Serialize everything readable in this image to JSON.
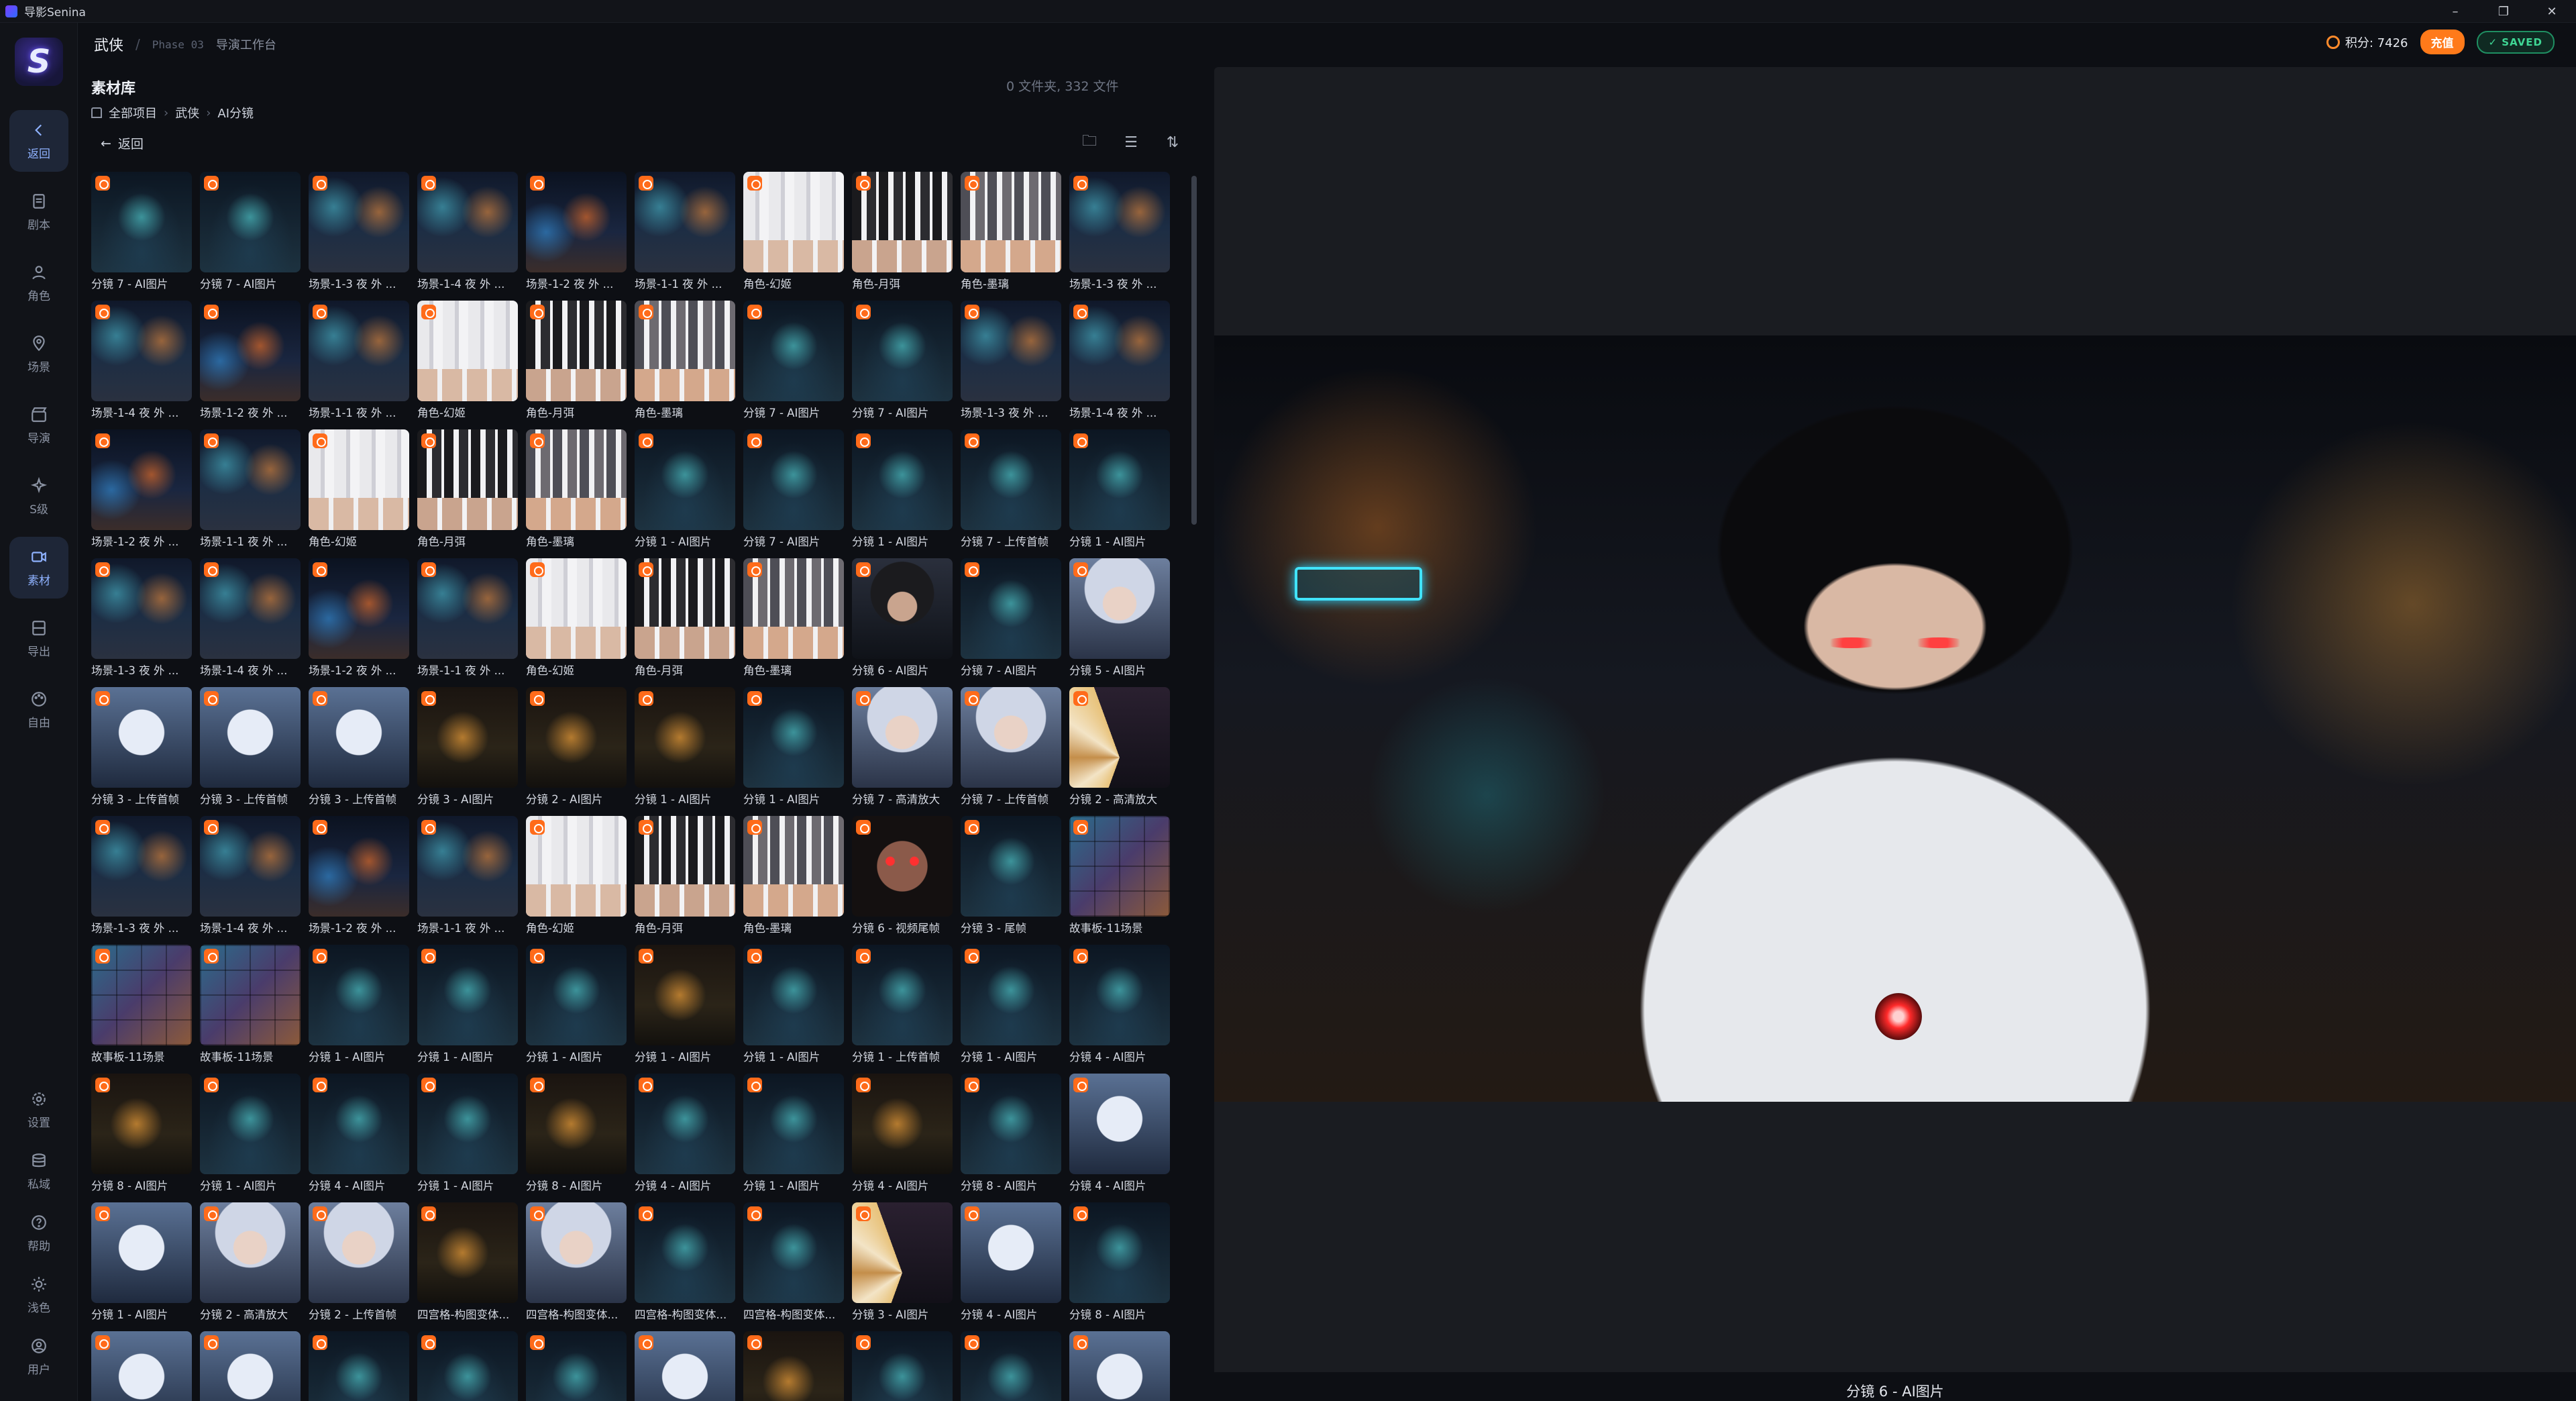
{
  "app": {
    "title": "导影Senina"
  },
  "window_controls": {
    "minimize": "–",
    "restore": "❐",
    "close": "✕"
  },
  "sidebar": {
    "items": [
      {
        "label": "返回",
        "icon": "chevron-left-icon",
        "active": true
      },
      {
        "label": "剧本",
        "icon": "document-icon",
        "active": false
      },
      {
        "label": "角色",
        "icon": "user-icon",
        "active": false
      },
      {
        "label": "场景",
        "icon": "location-icon",
        "active": false
      },
      {
        "label": "导演",
        "icon": "clapper-icon",
        "active": false
      },
      {
        "label": "S级",
        "icon": "sparkle-icon",
        "active": false
      },
      {
        "label": "素材",
        "icon": "video-icon",
        "active": true
      },
      {
        "label": "导出",
        "icon": "film-icon",
        "active": false
      },
      {
        "label": "自由",
        "icon": "palette-icon",
        "active": false
      }
    ],
    "bottom_items": [
      {
        "label": "设置",
        "icon": "gear-icon"
      },
      {
        "label": "私域",
        "icon": "database-icon"
      },
      {
        "label": "帮助",
        "icon": "help-icon"
      },
      {
        "label": "浅色",
        "icon": "sun-icon"
      },
      {
        "label": "用户",
        "icon": "user-circle-icon"
      }
    ]
  },
  "header": {
    "project": "武侠",
    "separator": "/",
    "phase": "Phase 03",
    "workspace": "导演工作台",
    "points_label": "积分: 7426",
    "recharge_label": "充值",
    "saved_label": "✓ SAVED"
  },
  "library": {
    "title": "素材库",
    "count": "0 文件夹, 332 文件",
    "breadcrumb": [
      "全部项目",
      "武侠",
      "AI分镜"
    ],
    "back_label": "返回",
    "tools": {
      "new_folder": "🗀",
      "list_view": "☰",
      "sort": "⇅"
    }
  },
  "grid": {
    "items": [
      {
        "cap": "分镜 7 - AI图片",
        "art": "action"
      },
      {
        "cap": "分镜 7 - AI图片",
        "art": "action"
      },
      {
        "cap": "场景-1-3 夜 外 ...",
        "art": "scene"
      },
      {
        "cap": "场景-1-4 夜 外 ...",
        "art": "scene"
      },
      {
        "cap": "场景-1-2 夜 外 ...",
        "art": "scene2"
      },
      {
        "cap": "场景-1-1 夜 外 ...",
        "art": "scene"
      },
      {
        "cap": "角色-幻姬",
        "art": "sheet-w"
      },
      {
        "cap": "角色-月弭",
        "art": "sheet-d"
      },
      {
        "cap": "角色-墨璃",
        "art": "sheet-g"
      },
      {
        "cap": "场景-1-3 夜 外 ...",
        "art": "scene"
      },
      {
        "cap": "场景-1-4 夜 外 ...",
        "art": "scene"
      },
      {
        "cap": "场景-1-2 夜 外 ...",
        "art": "scene2"
      },
      {
        "cap": "场景-1-1 夜 外 ...",
        "art": "scene"
      },
      {
        "cap": "角色-幻姬",
        "art": "sheet-w"
      },
      {
        "cap": "角色-月弭",
        "art": "sheet-d"
      },
      {
        "cap": "角色-墨璃",
        "art": "sheet-g"
      },
      {
        "cap": "分镜 7 - AI图片",
        "art": "action"
      },
      {
        "cap": "分镜 7 - AI图片",
        "art": "action"
      },
      {
        "cap": "场景-1-3 夜 外 ...",
        "art": "scene"
      },
      {
        "cap": "场景-1-4 夜 外 ...",
        "art": "scene"
      },
      {
        "cap": "场景-1-2 夜 外 ...",
        "art": "scene2"
      },
      {
        "cap": "场景-1-1 夜 外 ...",
        "art": "scene"
      },
      {
        "cap": "角色-幻姬",
        "art": "sheet-w"
      },
      {
        "cap": "角色-月弭",
        "art": "sheet-d"
      },
      {
        "cap": "角色-墨璃",
        "art": "sheet-g"
      },
      {
        "cap": "分镜 1 - AI图片",
        "art": "action"
      },
      {
        "cap": "分镜 7 - AI图片",
        "art": "action"
      },
      {
        "cap": "分镜 1 - AI图片",
        "art": "action"
      },
      {
        "cap": "分镜 7 - 上传首帧",
        "art": "action"
      },
      {
        "cap": "分镜 1 - AI图片",
        "art": "action"
      },
      {
        "cap": "场景-1-3 夜 外 ...",
        "art": "scene"
      },
      {
        "cap": "场景-1-4 夜 外 ...",
        "art": "scene"
      },
      {
        "cap": "场景-1-2 夜 外 ...",
        "art": "scene2"
      },
      {
        "cap": "场景-1-1 夜 外 ...",
        "art": "scene"
      },
      {
        "cap": "角色-幻姬",
        "art": "sheet-w"
      },
      {
        "cap": "角色-月弭",
        "art": "sheet-d"
      },
      {
        "cap": "角色-墨璃",
        "art": "sheet-g"
      },
      {
        "cap": "分镜 6 - AI图片",
        "art": "face-dark"
      },
      {
        "cap": "分镜 7 - AI图片",
        "art": "action"
      },
      {
        "cap": "分镜 5 - AI图片",
        "art": "face"
      },
      {
        "cap": "分镜 3 - 上传首帧",
        "art": "silver"
      },
      {
        "cap": "分镜 3 - 上传首帧",
        "art": "silver"
      },
      {
        "cap": "分镜 3 - 上传首帧",
        "art": "silver"
      },
      {
        "cap": "分镜 3 - AI图片",
        "art": "fire"
      },
      {
        "cap": "分镜 2 - AI图片",
        "art": "fire"
      },
      {
        "cap": "分镜 1 - AI图片",
        "art": "fire"
      },
      {
        "cap": "分镜 1 - AI图片",
        "art": "action"
      },
      {
        "cap": "分镜 7 - 高清放大",
        "art": "face"
      },
      {
        "cap": "分镜 7 - 上传首帧",
        "art": "face"
      },
      {
        "cap": "分镜 2 - 高清放大",
        "art": "fan"
      },
      {
        "cap": "场景-1-3 夜 外 ...",
        "art": "scene"
      },
      {
        "cap": "场景-1-4 夜 外 ...",
        "art": "scene"
      },
      {
        "cap": "场景-1-2 夜 外 ...",
        "art": "scene2"
      },
      {
        "cap": "场景-1-1 夜 外 ...",
        "art": "scene"
      },
      {
        "cap": "角色-幻姬",
        "art": "sheet-w"
      },
      {
        "cap": "角色-月弭",
        "art": "sheet-d"
      },
      {
        "cap": "角色-墨璃",
        "art": "sheet-g"
      },
      {
        "cap": "分镜 6 - 视频尾帧",
        "art": "red"
      },
      {
        "cap": "分镜 3 - 尾帧",
        "art": "action"
      },
      {
        "cap": "故事板-11场景",
        "art": "story"
      },
      {
        "cap": "故事板-11场景",
        "art": "story"
      },
      {
        "cap": "故事板-11场景",
        "art": "story"
      },
      {
        "cap": "分镜 1 - AI图片",
        "art": "action"
      },
      {
        "cap": "分镜 1 - AI图片",
        "art": "action"
      },
      {
        "cap": "分镜 1 - AI图片",
        "art": "action"
      },
      {
        "cap": "分镜 1 - AI图片",
        "art": "fire"
      },
      {
        "cap": "分镜 1 - AI图片",
        "art": "action"
      },
      {
        "cap": "分镜 1 - 上传首帧",
        "art": "action"
      },
      {
        "cap": "分镜 1 - AI图片",
        "art": "action"
      },
      {
        "cap": "分镜 4 - AI图片",
        "art": "action"
      },
      {
        "cap": "分镜 8 - AI图片",
        "art": "fire"
      },
      {
        "cap": "分镜 1 - AI图片",
        "art": "action"
      },
      {
        "cap": "分镜 4 - AI图片",
        "art": "action"
      },
      {
        "cap": "分镜 1 - AI图片",
        "art": "action"
      },
      {
        "cap": "分镜 8 - AI图片",
        "art": "fire"
      },
      {
        "cap": "分镜 4 - AI图片",
        "art": "action"
      },
      {
        "cap": "分镜 1 - AI图片",
        "art": "action"
      },
      {
        "cap": "分镜 4 - AI图片",
        "art": "fire"
      },
      {
        "cap": "分镜 8 - AI图片",
        "art": "action"
      },
      {
        "cap": "分镜 4 - AI图片",
        "art": "silver"
      },
      {
        "cap": "分镜 1 - AI图片",
        "art": "silver"
      },
      {
        "cap": "分镜 2 - 高清放大",
        "art": "face"
      },
      {
        "cap": "分镜 2 - 上传首帧",
        "art": "face"
      },
      {
        "cap": "四宫格-构图变体...",
        "art": "fire"
      },
      {
        "cap": "四宫格-构图变体...",
        "art": "face"
      },
      {
        "cap": "四宫格-构图变体...",
        "art": "action"
      },
      {
        "cap": "四宫格-构图变体...",
        "art": "action"
      },
      {
        "cap": "分镜 3 - AI图片",
        "art": "fan"
      },
      {
        "cap": "分镜 4 - AI图片",
        "art": "silver"
      },
      {
        "cap": "分镜 8 - AI图片",
        "art": "action"
      },
      {
        "cap": "",
        "art": "silver"
      },
      {
        "cap": "",
        "art": "silver"
      },
      {
        "cap": "",
        "art": "action"
      },
      {
        "cap": "",
        "art": "action"
      },
      {
        "cap": "",
        "art": "action"
      },
      {
        "cap": "",
        "art": "silver"
      },
      {
        "cap": "",
        "art": "fire"
      },
      {
        "cap": "",
        "art": "action"
      },
      {
        "cap": "",
        "art": "action"
      },
      {
        "cap": "",
        "art": "silver"
      }
    ]
  },
  "preview": {
    "caption": "分镜 6 - AI图片"
  }
}
